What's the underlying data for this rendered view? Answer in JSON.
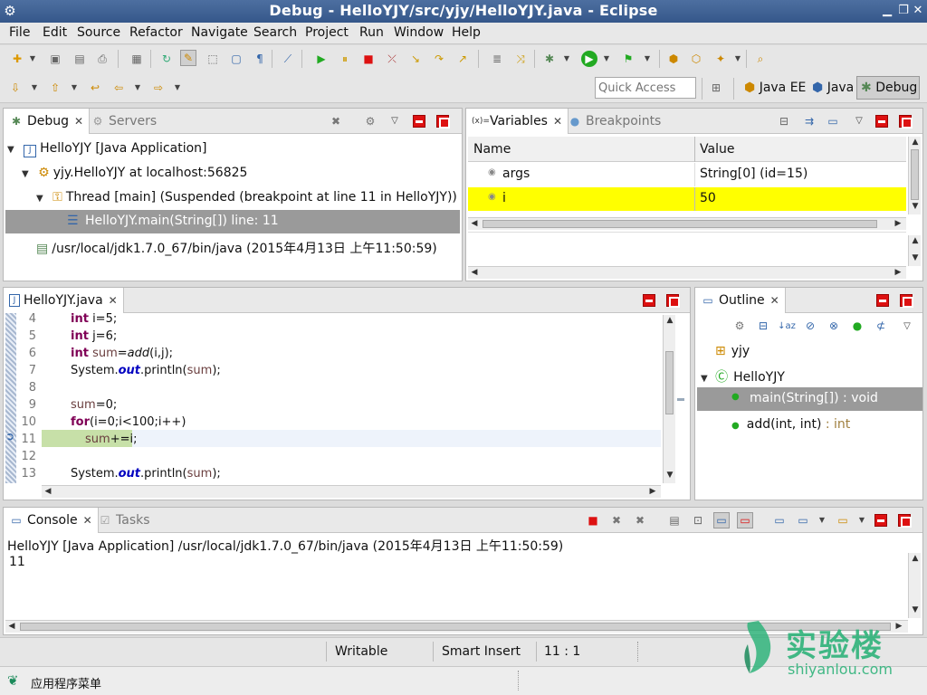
{
  "window": {
    "title": "Debug - HelloYJY/src/yjy/HelloYJY.java - Eclipse"
  },
  "menu": [
    "File",
    "Edit",
    "Source",
    "Refactor",
    "Navigate",
    "Search",
    "Project",
    "Run",
    "Window",
    "Help"
  ],
  "quick_access": {
    "placeholder": "Quick Access"
  },
  "perspectives": {
    "java_ee": "Java EE",
    "java": "Java",
    "debug": "Debug"
  },
  "debug_view": {
    "tab_label": "Debug",
    "other_tab": "Servers",
    "tree": {
      "app": "HelloYJY [Java Application]",
      "vm": "yjy.HelloYJY at localhost:56825",
      "thread": "Thread [main] (Suspended (breakpoint at line 11 in HelloYJY))",
      "frame": "HelloYJY.main(String[]) line: 11",
      "process": "/usr/local/jdk1.7.0_67/bin/java (2015年4月13日 上午11:50:59)"
    }
  },
  "variables_view": {
    "tab_label": "Variables",
    "other_tab": "Breakpoints",
    "col_name": "Name",
    "col_value": "Value",
    "rows": [
      {
        "name": "args",
        "value": "String[0]  (id=15)"
      },
      {
        "name": "i",
        "value": "50"
      }
    ],
    "highlight_color": "#ffff00"
  },
  "editor": {
    "tab_label": "HelloYJY.java",
    "lines": [
      {
        "num": "4"
      },
      {
        "num": "5"
      },
      {
        "num": "6"
      },
      {
        "num": "7"
      },
      {
        "num": "8"
      },
      {
        "num": "9"
      },
      {
        "num": "10"
      },
      {
        "num": "11"
      },
      {
        "num": "12"
      },
      {
        "num": "13"
      }
    ],
    "code": {
      "l4_kw": "int",
      "l4_rest": " i=5;",
      "l5_kw": "int",
      "l5_rest": " j=6;",
      "l6_kw": "int",
      "l6_var": " sum",
      "l6_eq": "=",
      "l6_m": "add",
      "l6_rest": "(i,j);",
      "l7_a": "System.",
      "l7_f": "out",
      "l7_b": ".println(",
      "l7_v": "sum",
      "l7_c": ");",
      "l9_v": "sum",
      "l9_rest": "=0;",
      "l10_kw": "for",
      "l10_rest": "(i=0;i<100;i++)",
      "l11_v": "sum",
      "l11_rest": "+=i;",
      "l13_a": "System.",
      "l13_f": "out",
      "l13_b": ".println(",
      "l13_v": "sum",
      "l13_c": ");"
    },
    "current_line_color": "#c7e0a8"
  },
  "outline_view": {
    "tab_label": "Outline",
    "items": {
      "package": "yjy",
      "class": "HelloYJY",
      "method1": "main(String[]) : void",
      "method2_name": "add(int, int)",
      "method2_type": " : int"
    }
  },
  "console_view": {
    "tab_label": "Console",
    "other_tab": "Tasks",
    "header": "HelloYJY [Java Application] /usr/local/jdk1.7.0_67/bin/java (2015年4月13日 上午11:50:59)",
    "output": "11"
  },
  "status": {
    "writable": "Writable",
    "insert_mode": "Smart Insert",
    "position": "11 : 1"
  },
  "taskbar": {
    "menu_label": "应用程序菜单"
  },
  "watermark": {
    "name": "实验楼",
    "url": "shiyanlou.com"
  }
}
